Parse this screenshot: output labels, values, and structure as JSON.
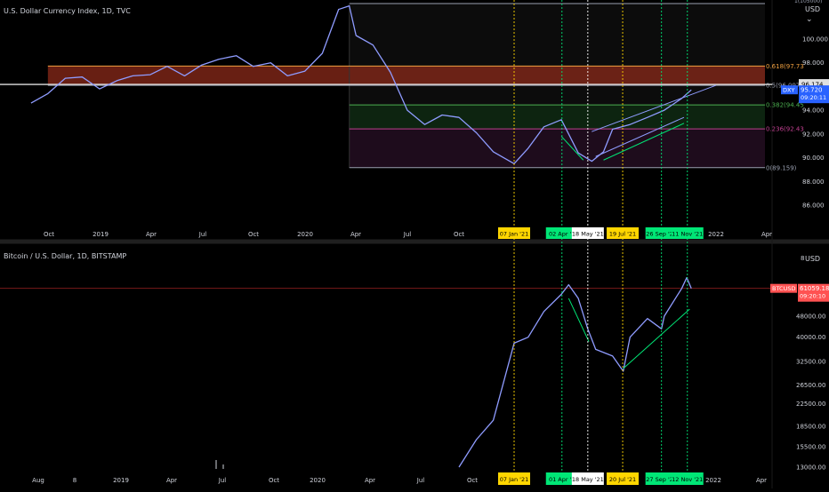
{
  "panes": [
    {
      "title": "U.S. Dollar Currency Index, 1D, TVC",
      "currency": "USD",
      "scale_top_text": "1(105000)",
      "y_ticks": [
        "100.000",
        "98.000",
        "96.000",
        "94.000",
        "92.000",
        "90.000",
        "88.000",
        "86.000"
      ],
      "y_tick_values": [
        100,
        98,
        96,
        94,
        92,
        90,
        88,
        86
      ],
      "x_ticks": [
        "Oct",
        "2019",
        "Apr",
        "Jul",
        "Oct",
        "2020",
        "Apr",
        "Jul",
        "Oct",
        "2022",
        "Apr"
      ],
      "fib_levels": [
        {
          "label": "0.618(97.73",
          "value": 97.73,
          "color": "#f0a040"
        },
        {
          "label": "0.5(96.097)",
          "value": 96.097,
          "color": "#9aa0b0"
        },
        {
          "label": "0.382(94.45",
          "value": 94.45,
          "color": "#4caf50"
        },
        {
          "label": "0.236(92.43",
          "value": 92.43,
          "color": "#c04090"
        },
        {
          "label": "0(89.159)",
          "value": 89.159,
          "color": "#9aa0b0"
        }
      ],
      "horizontal_line": {
        "label": "96.174",
        "value": 96.174
      },
      "price_tag": {
        "symbol": "DXY",
        "price": "95.720",
        "countdown": "09:20:11"
      }
    },
    {
      "title": "Bitcoin / U.S. Dollar, 1D, BITSTAMP",
      "currency": "USD",
      "scale_top_text": "8",
      "y_ticks": [
        "48000.00",
        "40000.00",
        "32500.00",
        "26500.00",
        "22500.00",
        "18500.00",
        "15500.00",
        "13000.00"
      ],
      "y_tick_values": [
        48000,
        40000,
        32500,
        26500,
        22500,
        18500,
        15500,
        13000
      ],
      "x_ticks": [
        "Aug",
        "8",
        "2019",
        "Apr",
        "Jul",
        "Oct",
        "2020",
        "Apr",
        "Jul",
        "Oct",
        "2022",
        "Apr"
      ],
      "horizontal_line": {
        "value": 61059.18
      },
      "price_tag": {
        "symbol": "BTCUSD",
        "price": "61059.18",
        "countdown": "09:20:10"
      }
    }
  ],
  "vertical_markers": [
    {
      "label_top": "07 Jan '21",
      "label_bottom": "07 Jan '21",
      "color": "#ffd600",
      "line": "#ffd600",
      "date": "2021-01-07"
    },
    {
      "label_top": "02 Apr '2",
      "label_bottom": "01 Apr '2",
      "color": "#00e676",
      "line": "#00e676",
      "date": "2021-04-02"
    },
    {
      "label_top": "18 May '21",
      "label_bottom": "18 May '21",
      "color": "#ffffff",
      "line": "#ffffff",
      "date": "2021-05-18"
    },
    {
      "label_top": "19 Jul '21",
      "label_bottom": "20 Jul '21",
      "color": "#ffd600",
      "line": "#ffd600",
      "date": "2021-07-19"
    },
    {
      "label_top": "26 Sep '21",
      "label_bottom": "27 Sep '21",
      "color": "#00e676",
      "line": "#00e676",
      "date": "2021-09-26"
    },
    {
      "label_top": "11 Nov '21",
      "label_bottom": "12 Nov '21",
      "color": "#00e676",
      "line": "#00e676",
      "date": "2021-11-11"
    }
  ],
  "colors": {
    "background": "#000000",
    "candles": "#8f9cff",
    "fib_zone": "#8b2a1a",
    "btc_line": "#ff5252",
    "grid": "#1a1a1a"
  },
  "chart_data": [
    {
      "type": "line",
      "title": "U.S. Dollar Currency Index, 1D, TVC",
      "x": [
        "2018-09-01",
        "2018-10-01",
        "2018-11-01",
        "2018-12-01",
        "2019-01-01",
        "2019-02-01",
        "2019-03-01",
        "2019-04-01",
        "2019-05-01",
        "2019-06-01",
        "2019-07-01",
        "2019-08-01",
        "2019-09-01",
        "2019-10-01",
        "2019-11-01",
        "2019-12-01",
        "2020-01-01",
        "2020-02-01",
        "2020-03-01",
        "2020-03-20",
        "2020-04-01",
        "2020-05-01",
        "2020-06-01",
        "2020-07-01",
        "2020-08-01",
        "2020-09-01",
        "2020-10-01",
        "2020-11-01",
        "2020-12-01",
        "2021-01-07",
        "2021-02-01",
        "2021-03-01",
        "2021-04-01",
        "2021-05-01",
        "2021-05-25",
        "2021-06-15",
        "2021-07-01",
        "2021-08-01",
        "2021-09-01",
        "2021-10-01",
        "2021-11-01",
        "2021-11-18"
      ],
      "series": [
        {
          "values": [
            94.6,
            95.4,
            96.7,
            96.8,
            95.8,
            96.5,
            96.9,
            97.0,
            97.7,
            96.9,
            97.8,
            98.3,
            98.6,
            97.7,
            98.0,
            96.9,
            97.3,
            98.8,
            102.5,
            102.8,
            100.3,
            99.5,
            97.2,
            94.0,
            92.8,
            93.6,
            93.4,
            92.1,
            90.5,
            89.5,
            90.8,
            92.6,
            93.2,
            90.4,
            89.7,
            90.5,
            92.4,
            92.8,
            93.4,
            94.0,
            95.0,
            95.72
          ]
        }
      ],
      "ylim": [
        85,
        105
      ]
    },
    {
      "type": "line",
      "title": "Bitcoin / U.S. Dollar, 1D, BITSTAMP",
      "x": [
        "2020-10-01",
        "2020-11-01",
        "2020-12-01",
        "2021-01-07",
        "2021-02-01",
        "2021-03-01",
        "2021-04-01",
        "2021-04-14",
        "2021-05-01",
        "2021-05-18",
        "2021-06-01",
        "2021-07-01",
        "2021-07-20",
        "2021-08-01",
        "2021-09-01",
        "2021-09-26",
        "2021-10-01",
        "2021-11-01",
        "2021-11-10",
        "2021-11-18"
      ],
      "series": [
        {
          "values": [
            13000,
            16500,
            19500,
            38000,
            40000,
            50000,
            58000,
            63000,
            56000,
            43000,
            36000,
            34000,
            29800,
            40000,
            47000,
            43000,
            48000,
            61000,
            67000,
            61059.18
          ]
        }
      ],
      "log_scale": true,
      "ylim": [
        12500,
        80000
      ]
    }
  ]
}
